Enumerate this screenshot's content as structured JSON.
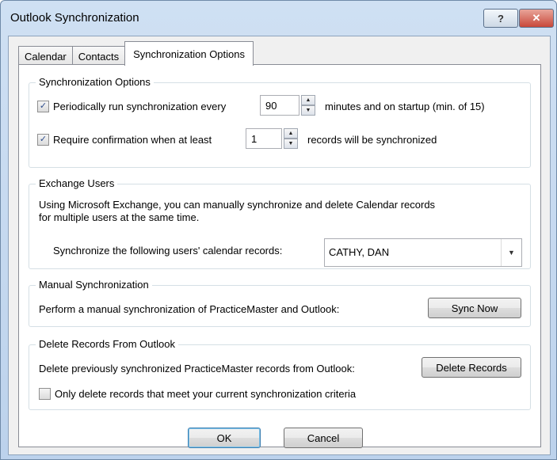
{
  "window": {
    "title": "Outlook Synchronization",
    "help_glyph": "?",
    "close_glyph": "✕"
  },
  "tabs": [
    {
      "label": "Calendar",
      "active": false
    },
    {
      "label": "Contacts",
      "active": false
    },
    {
      "label": "Synchronization Options",
      "active": true
    }
  ],
  "sync_options": {
    "legend": "Synchronization Options",
    "periodic": {
      "checked": true,
      "label": "Periodically run synchronization every",
      "value": "90",
      "suffix": "minutes and on startup (min. of 15)"
    },
    "confirm": {
      "checked": true,
      "label": "Require confirmation when at least",
      "value": "1",
      "suffix": "records will be synchronized"
    }
  },
  "exchange": {
    "legend": "Exchange Users",
    "description_line1": "Using Microsoft Exchange, you can manually synchronize and delete Calendar records",
    "description_line2": "for multiple users at the same time.",
    "users_label": "Synchronize the following users' calendar records:",
    "users_value": "CATHY, DAN"
  },
  "manual": {
    "legend": "Manual Synchronization",
    "description": "Perform a manual synchronization of PracticeMaster and Outlook:",
    "button": "Sync Now"
  },
  "delete": {
    "legend": "Delete Records From Outlook",
    "description": "Delete previously synchronized PracticeMaster records from Outlook:",
    "button": "Delete Records",
    "only_matching": {
      "checked": false,
      "label": "Only delete records that meet your current synchronization criteria"
    }
  },
  "footer": {
    "ok": "OK",
    "cancel": "Cancel"
  },
  "icons": {
    "check": "✓",
    "spin_up": "▲",
    "spin_down": "▼",
    "dropdown": "▼"
  }
}
